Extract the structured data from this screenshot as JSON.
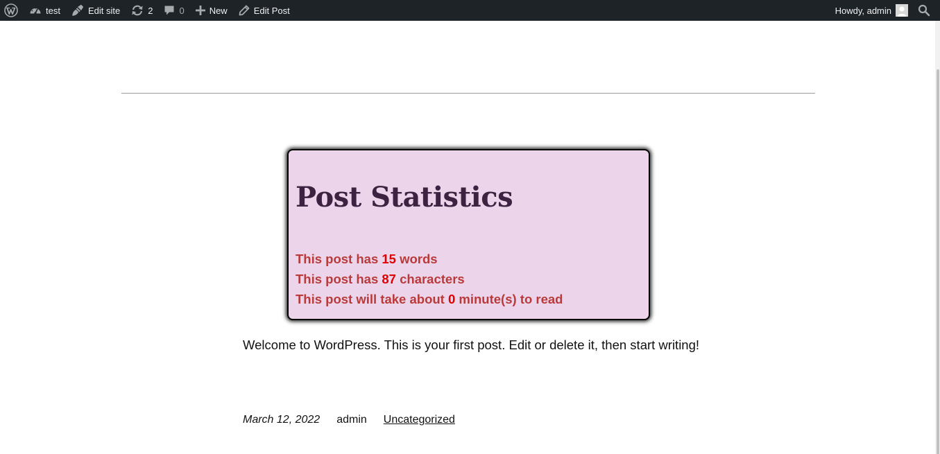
{
  "admin_bar": {
    "site_name": "test",
    "edit_site_label": "Edit site",
    "updates_count": "2",
    "comments_count": "0",
    "new_label": "New",
    "edit_post_label": "Edit Post",
    "howdy_label": "Howdy, admin"
  },
  "post": {
    "stats": {
      "title": "Post Statistics",
      "words_prefix": "This post has ",
      "words_count": "15",
      "words_suffix": " words",
      "chars_prefix": "This post has ",
      "chars_count": "87",
      "chars_suffix": " characters",
      "read_prefix": "This post will take about ",
      "read_count": "0",
      "read_suffix": " minute(s) to read"
    },
    "content": "Welcome to WordPress. This is your first post. Edit or delete it, then start writing!",
    "date": "March 12, 2022",
    "author": "admin",
    "category": "Uncategorized"
  },
  "icons": {
    "wp_logo": "wordpress-logo-icon",
    "dashboard": "dashboard-gauge-icon",
    "edit_site": "brush-icon",
    "updates": "refresh-icon",
    "comments": "comment-bubble-icon",
    "new": "plus-icon",
    "edit_post": "pencil-icon",
    "avatar": "avatar-icon",
    "search": "search-icon"
  },
  "colors": {
    "admin_bar_bg": "#1d2327",
    "stats_bg": "#ecd5ea",
    "stats_title": "#3e2241",
    "stats_text": "#b93a3a",
    "stats_number": "#e00000"
  }
}
